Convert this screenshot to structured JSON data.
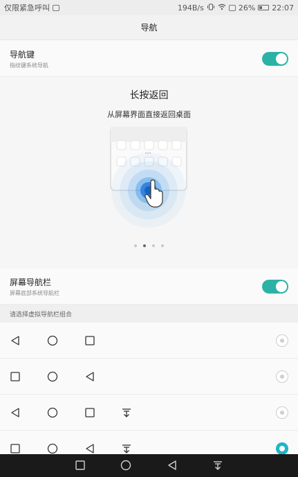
{
  "status_bar": {
    "carrier_text": "仅限紧急呼叫",
    "net_speed": "194B/s",
    "battery": "26%",
    "time": "22:07",
    "icons": [
      "vibrate-icon",
      "wifi-icon",
      "sim-icon",
      "battery-icon"
    ]
  },
  "page": {
    "title": "导航"
  },
  "nav_keys": {
    "title": "导航键",
    "subtitle": "指纹键系统导航",
    "enabled": true
  },
  "demo": {
    "title": "长按返回",
    "subtitle": "从屏幕界面直接返回桌面",
    "page_count": 4,
    "active_page": 1
  },
  "screen_nav": {
    "title": "屏幕导航栏",
    "subtitle": "屏幕底部系统导航栏",
    "enabled": true
  },
  "combinations": {
    "header": "请选择虚拟导航栏组合",
    "options": [
      {
        "keys": [
          "back",
          "home",
          "recent"
        ],
        "selected": false
      },
      {
        "keys": [
          "recent",
          "home",
          "back"
        ],
        "selected": false
      },
      {
        "keys": [
          "back",
          "home",
          "recent",
          "notification"
        ],
        "selected": false
      },
      {
        "keys": [
          "recent",
          "home",
          "back",
          "notification"
        ],
        "selected": true
      }
    ]
  },
  "system_nav": {
    "keys": [
      "recent",
      "home",
      "back",
      "notification"
    ]
  },
  "colors": {
    "accent": "#2bb2a6",
    "radio_selected": "#1fb5c8",
    "nav_bar": "#1a1a1a"
  }
}
